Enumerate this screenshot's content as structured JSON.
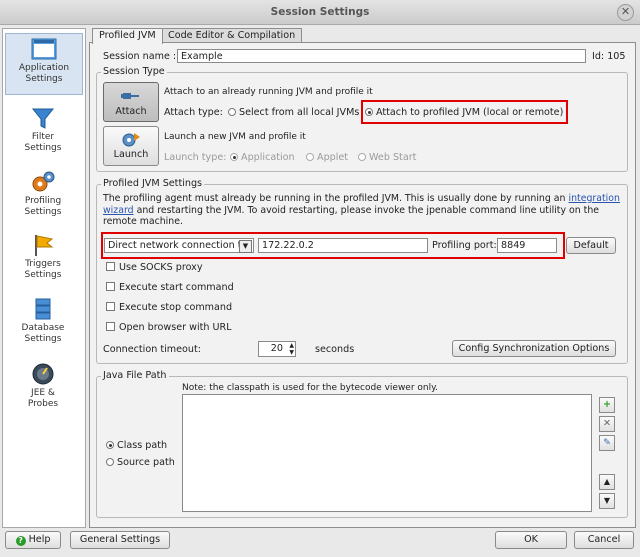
{
  "window": {
    "title": "Session Settings",
    "close_glyph": "✕"
  },
  "sidebar": {
    "items": [
      {
        "label_1": "Application",
        "label_2": "Settings",
        "icon": "application-window-icon"
      },
      {
        "label_1": "Filter",
        "label_2": "Settings",
        "icon": "filter-funnel-icon"
      },
      {
        "label_1": "Profiling",
        "label_2": "Settings",
        "icon": "gears-icon"
      },
      {
        "label_1": "Triggers",
        "label_2": "Settings",
        "icon": "flag-icon"
      },
      {
        "label_1": "Database",
        "label_2": "Settings",
        "icon": "database-icon"
      },
      {
        "label_1": "JEE &",
        "label_2": "Probes",
        "icon": "gauge-icon"
      }
    ]
  },
  "tabs": {
    "profiled_jvm": "Profiled JVM",
    "code_editor": "Code Editor & Compilation"
  },
  "session": {
    "name_label": "Session name :",
    "name_value": "Example",
    "id_label": "Id: 105"
  },
  "session_type": {
    "legend": "Session Type",
    "attach_button": "Attach",
    "attach_desc": "Attach to an already running JVM and profile it",
    "attach_type_label": "Attach type:",
    "attach_opt_local": "Select from all local JVMs",
    "attach_opt_remote": "Attach to profiled JVM (local or remote)",
    "launch_button": "Launch",
    "launch_desc": "Launch a new JVM and profile it",
    "launch_type_label": "Launch type:",
    "launch_opt_app": "Application",
    "launch_opt_applet": "Applet",
    "launch_opt_webstart": "Web Start"
  },
  "profiled_jvm": {
    "legend": "Profiled JVM Settings",
    "info_1a": "The profiling agent must already be running in the profiled JVM. This is usually done by running an ",
    "info_link_1": "integration",
    "info_link_2": "wizard",
    "info_2b": " and restarting the JVM. To avoid restarting, please invoke the jpenable command line utility on the",
    "info_3": "remote machine.",
    "connection_type": "Direct network connection to",
    "host": "172.22.0.2",
    "port_label": "Profiling port:",
    "port_value": "8849",
    "default_button": "Default",
    "opt_socks": "Use SOCKS proxy",
    "opt_start": "Execute start command",
    "opt_stop": "Execute stop command",
    "opt_browser": "Open browser with URL",
    "timeout_label": "Connection timeout:",
    "timeout_value": "20",
    "timeout_unit": "seconds",
    "sync_button": "Config Synchronization Options"
  },
  "java_path": {
    "legend": "Java File Path",
    "note": "Note: the classpath is used for the bytecode viewer only.",
    "opt_class": "Class path",
    "opt_source": "Source path"
  },
  "footer": {
    "help": "Help",
    "general": "General Settings",
    "ok": "OK",
    "cancel": "Cancel"
  }
}
